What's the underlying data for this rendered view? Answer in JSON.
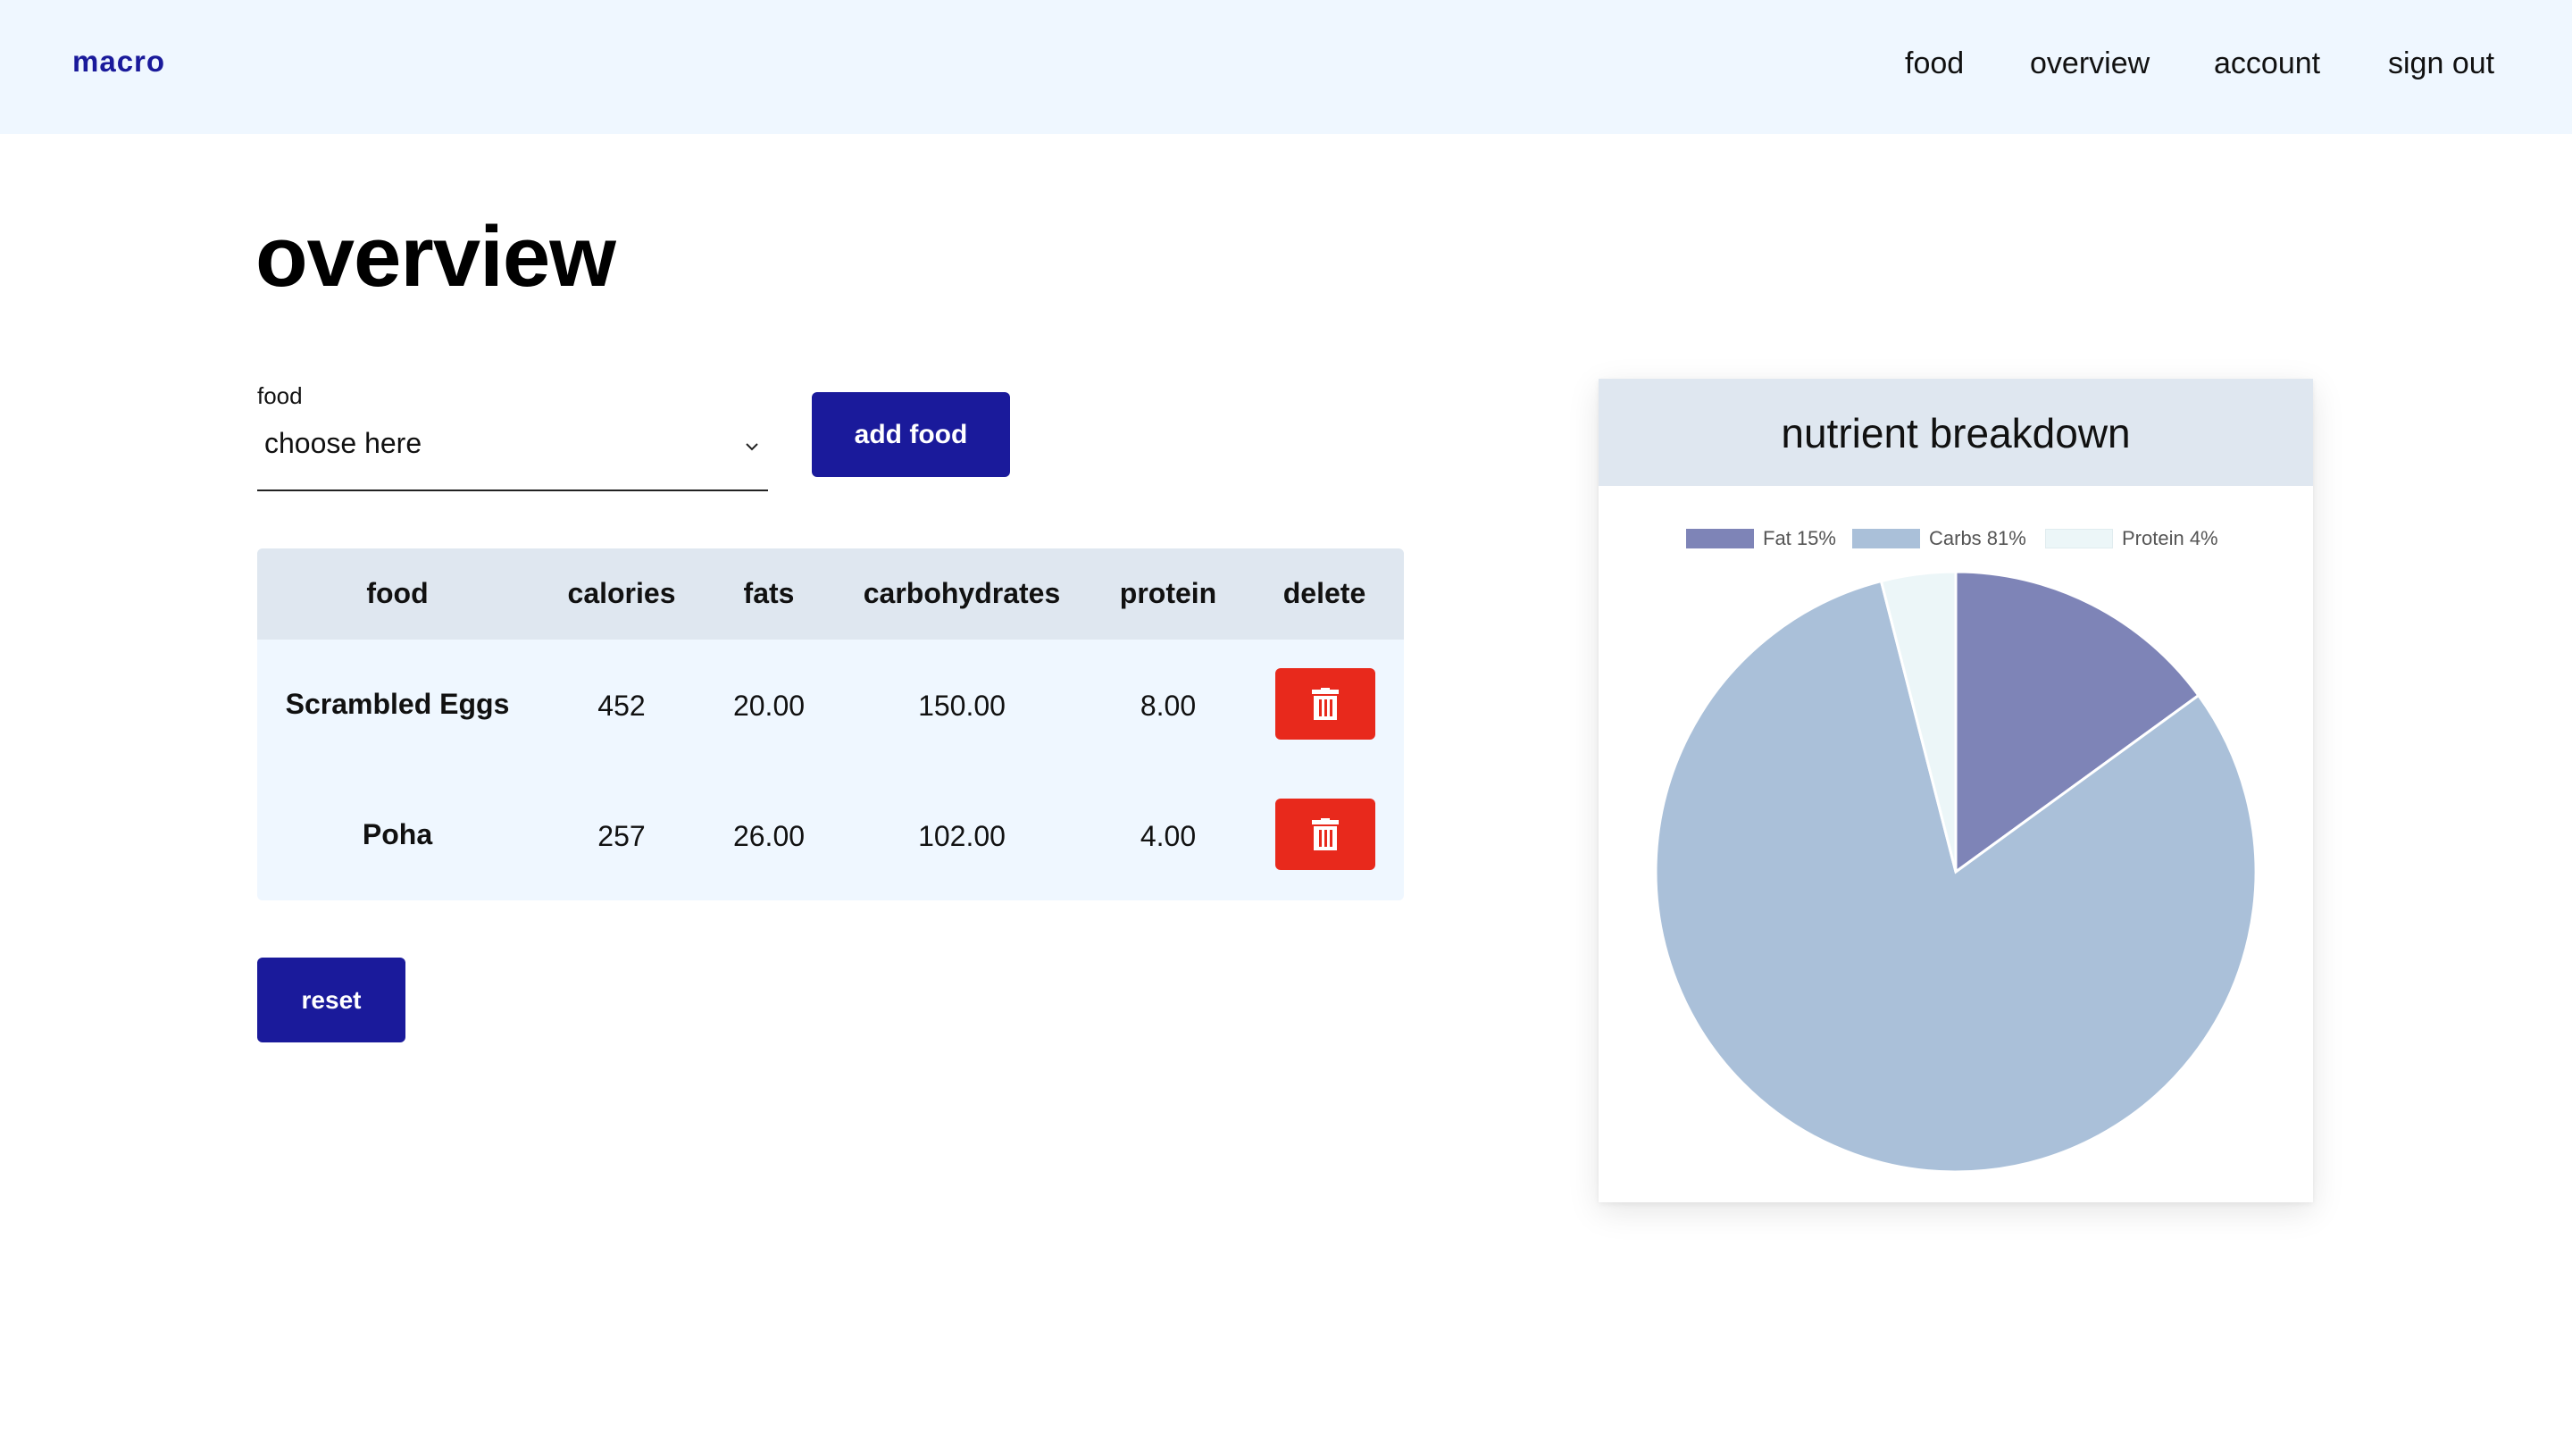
{
  "nav": {
    "brand": "macro",
    "links": [
      "food",
      "overview",
      "account",
      "sign out"
    ]
  },
  "page": {
    "title": "overview"
  },
  "food_select": {
    "label": "food",
    "value": "choose here"
  },
  "buttons": {
    "add_food": "add food",
    "reset": "reset"
  },
  "table": {
    "headers": [
      "food",
      "calories",
      "fats",
      "carbohydrates",
      "protein",
      "delete"
    ],
    "rows": [
      {
        "food": "Scrambled Eggs",
        "calories": "452",
        "fats": "20.00",
        "carbohydrates": "150.00",
        "protein": "8.00"
      },
      {
        "food": "Poha",
        "calories": "257",
        "fats": "26.00",
        "carbohydrates": "102.00",
        "protein": "4.00"
      }
    ]
  },
  "chart_card": {
    "title": "nutrient breakdown"
  },
  "chart_data": {
    "type": "pie",
    "title": "nutrient breakdown",
    "legend_position": "top",
    "slices": [
      {
        "label": "Fat 15%",
        "value": 15,
        "color": "#7e84b7"
      },
      {
        "label": "Carbs 81%",
        "value": 81,
        "color": "#aac0d9"
      },
      {
        "label": "Protein 4%",
        "value": 4,
        "color": "#ecf6f8"
      }
    ]
  },
  "colors": {
    "accent": "#1a1a9b",
    "navbar_bg": "#eff7ff",
    "table_head_bg": "#dfe7f0",
    "table_body_bg": "#eff7ff",
    "delete": "#e8291c"
  },
  "icons": {
    "delete": "trash-icon",
    "select": "chevron-down-icon"
  }
}
